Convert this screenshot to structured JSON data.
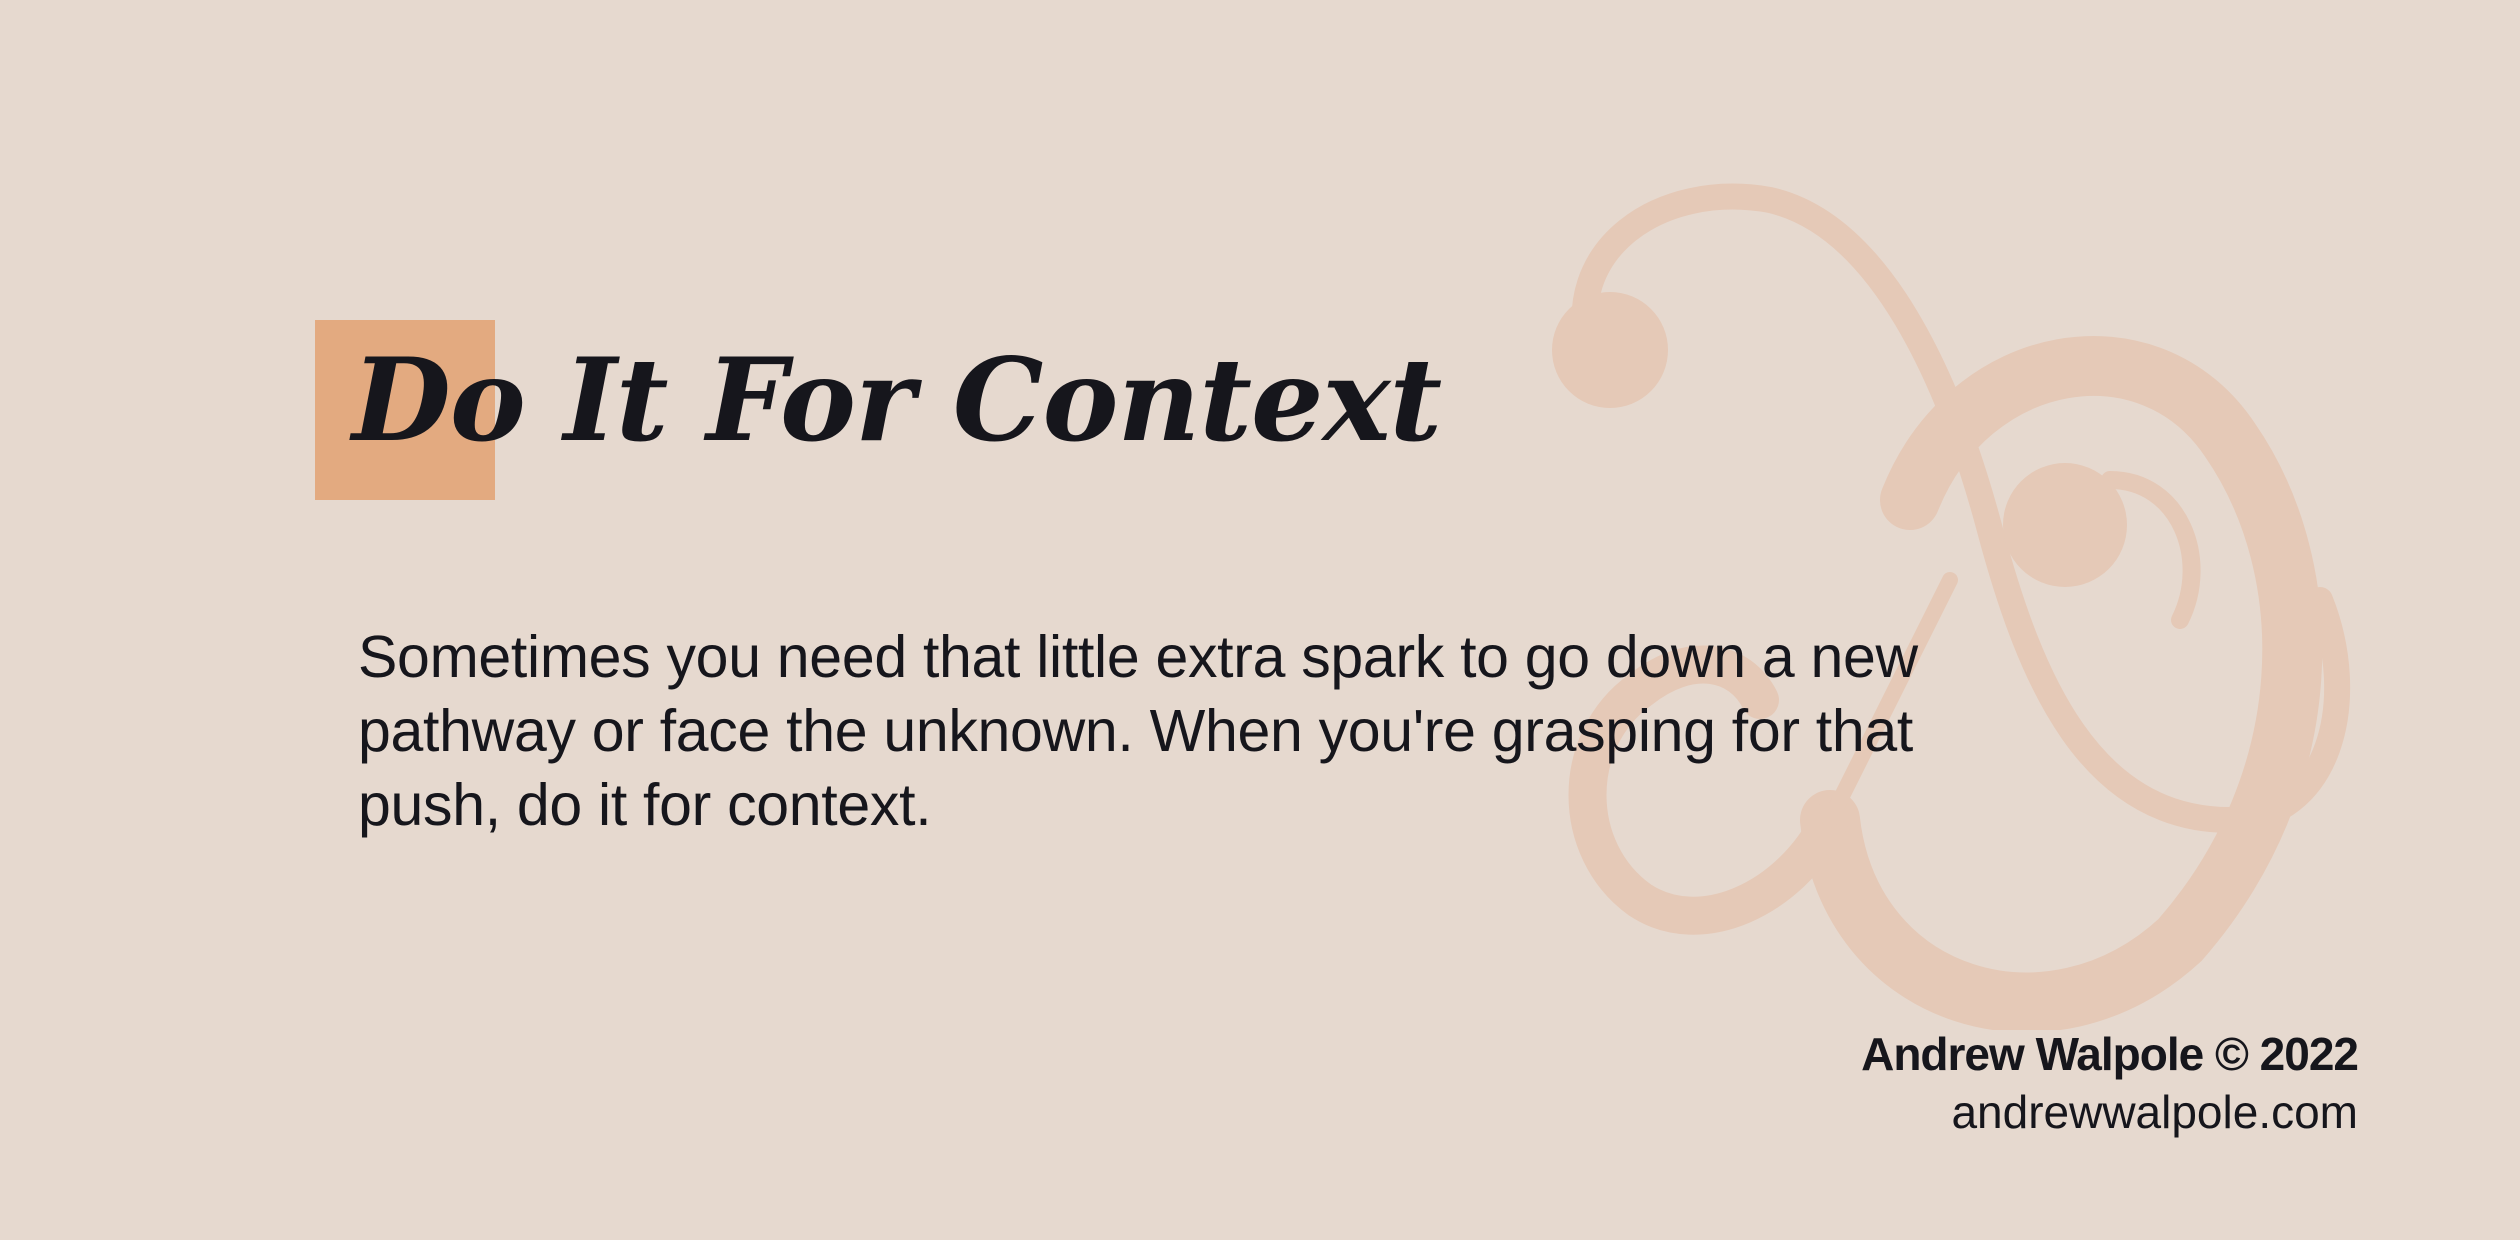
{
  "colors": {
    "background": "#e6d9cf",
    "accent": "#e3aa80",
    "ampersand": "#e5c9b7",
    "text": "#16161c"
  },
  "title": "Do It For Context",
  "description": {
    "lines": [
      "Sometimes you need that little extra spark to go down a new",
      "pathway or face the unknown. When you're grasping for that",
      "push, do it for context."
    ]
  },
  "footer": {
    "copyright": "Andrew Walpole © 2022",
    "website": "andrewwalpole.com"
  },
  "decoration": {
    "icon": "ampersand-icon"
  }
}
